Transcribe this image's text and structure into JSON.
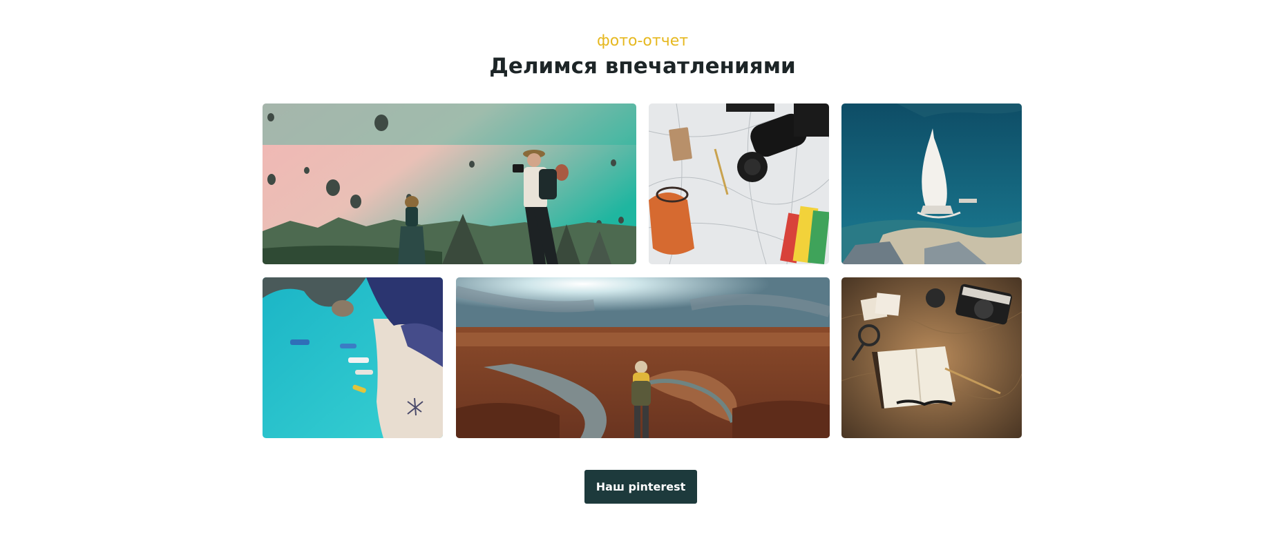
{
  "section": {
    "eyebrow": "фото-отчет",
    "title": "Делимся впечатлениями"
  },
  "gallery": {
    "photos": [
      {
        "subject": "hot-air-balloons-travelers"
      },
      {
        "subject": "map-camera-backpack-flatlay"
      },
      {
        "subject": "burj-al-arab-aerial"
      },
      {
        "subject": "turquoise-beach-boats-aerial"
      },
      {
        "subject": "canyon-hiker-horseshoe-bend"
      },
      {
        "subject": "vintage-camera-notebook-map"
      }
    ]
  },
  "cta": {
    "label": "Наш pinterest"
  },
  "colors": {
    "accent": "#e6b81f",
    "heading": "#1d2527",
    "button_bg": "#1d3a3c",
    "button_text": "#ffffff"
  }
}
